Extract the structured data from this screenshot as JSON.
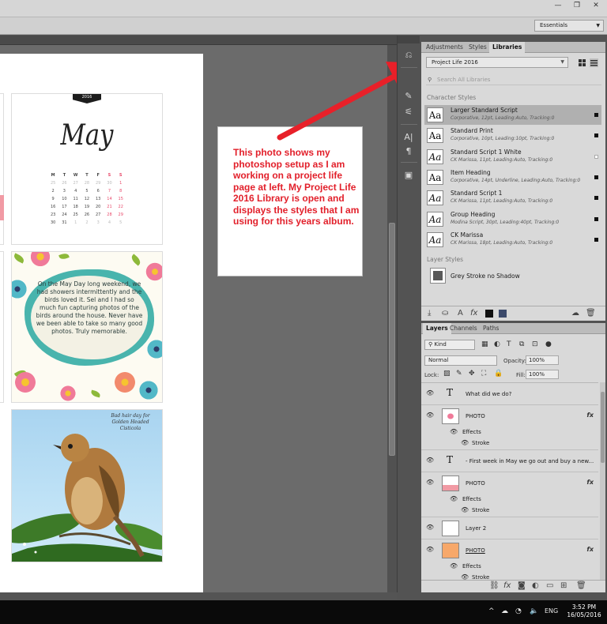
{
  "window": {
    "minimize": "—",
    "restore": "❐",
    "close": "✕"
  },
  "options_bar": {
    "workspace": "Essentials"
  },
  "document": {
    "calendar": {
      "year": "2016",
      "month": "May",
      "weekdays": [
        "M",
        "T",
        "W",
        "T",
        "F",
        "S",
        "S"
      ],
      "weeks": [
        [
          "25",
          "26",
          "27",
          "28",
          "29",
          "30",
          "1"
        ],
        [
          "2",
          "3",
          "4",
          "5",
          "6",
          "7",
          "8"
        ],
        [
          "9",
          "10",
          "11",
          "12",
          "13",
          "14",
          "15"
        ],
        [
          "16",
          "17",
          "18",
          "19",
          "20",
          "21",
          "22"
        ],
        [
          "23",
          "24",
          "25",
          "26",
          "27",
          "28",
          "29"
        ],
        [
          "30",
          "31",
          "1",
          "2",
          "3",
          "4",
          "5"
        ]
      ]
    },
    "journal_quote": "On the May Day long weekend, we had showers intermittently and the birds loved it. Sel and I had so much fun capturing photos of the birds around the house. Never have we been able to take so many good photos. Truly memorable.",
    "bird_caption": "Bad hair day for Golden Headed Cisticola",
    "note": "This photo shows my photoshop setup as I am working on a project life page at left. My Project Life 2016 Library is open and displays the styles that I am using for this years album."
  },
  "colors": {
    "annotation_red": "#e21f2a",
    "accent_pink": "#e94a6b",
    "teal": "#49b4ad"
  },
  "libraries_panel": {
    "tabs": [
      "Adjustments",
      "Styles",
      "Libraries"
    ],
    "active_tab": "Libraries",
    "library": "Project Life 2016",
    "search_placeholder": "Search All Libraries",
    "character_styles_label": "Character Styles",
    "character_styles": [
      {
        "name": "Larger Standard Script",
        "desc": "Corporative, 12pt, Leading:Auto, Tracking:0",
        "glyph": "Aa",
        "selected": true,
        "swatch": "black"
      },
      {
        "name": "Standard Print",
        "desc": "Corporative, 10pt, Leading:10pt, Tracking:0",
        "glyph": "Aa",
        "selected": false,
        "swatch": "black"
      },
      {
        "name": "Standard Script 1 White",
        "desc": "CK Marissa, 11pt, Leading:Auto, Tracking:0",
        "glyph": "Aa",
        "selected": false,
        "swatch": "white"
      },
      {
        "name": "Item Heading",
        "desc": "Corporative, 14pt, Underline, Leading:Auto, Tracking:0",
        "glyph": "Aa",
        "selected": false,
        "swatch": "black"
      },
      {
        "name": "Standard Script 1",
        "desc": "CK Marissa, 11pt, Leading:Auto, Tracking:0",
        "glyph": "Aa",
        "selected": false,
        "swatch": "black"
      },
      {
        "name": "Group Heading",
        "desc": "Modina Script, 30pt, Leading:40pt, Tracking:0",
        "glyph": "Aa",
        "selected": false,
        "swatch": "black"
      },
      {
        "name": "CK Marissa",
        "desc": "CK Marissa, 18pt, Leading:Auto, Tracking:0",
        "glyph": "Aa",
        "selected": false,
        "swatch": "black"
      }
    ],
    "layer_styles_label": "Layer Styles",
    "layer_style": "Grey Stroke no Shadow"
  },
  "layers_panel": {
    "tabs": [
      "Layers",
      "Channels",
      "Paths"
    ],
    "kind_filter": "Kind",
    "blend_mode": "Normal",
    "opacity_label": "Opacity:",
    "opacity": "100%",
    "lock_label": "Lock:",
    "fill_label": "Fill:",
    "fill": "100%",
    "layers": [
      {
        "type": "text",
        "name": "What did we do?"
      },
      {
        "type": "photo",
        "name": "PHOTO",
        "fx": "fx",
        "effects": "Effects",
        "stroke": "Stroke",
        "thumb": "floral"
      },
      {
        "type": "text",
        "name": "- First week in May we go out and buy a new..."
      },
      {
        "type": "photo",
        "name": "PHOTO",
        "fx": "fx",
        "effects": "Effects",
        "stroke": "Stroke",
        "thumb": "pink"
      },
      {
        "type": "plain",
        "name": "Layer 2"
      },
      {
        "type": "photo",
        "name": "PHOTO",
        "fx": "fx",
        "effects": "Effects",
        "stroke": "Stroke",
        "thumb": "orange"
      }
    ]
  },
  "taskbar": {
    "language": "ENG",
    "time": "3:52 PM",
    "date": "16/05/2016"
  }
}
